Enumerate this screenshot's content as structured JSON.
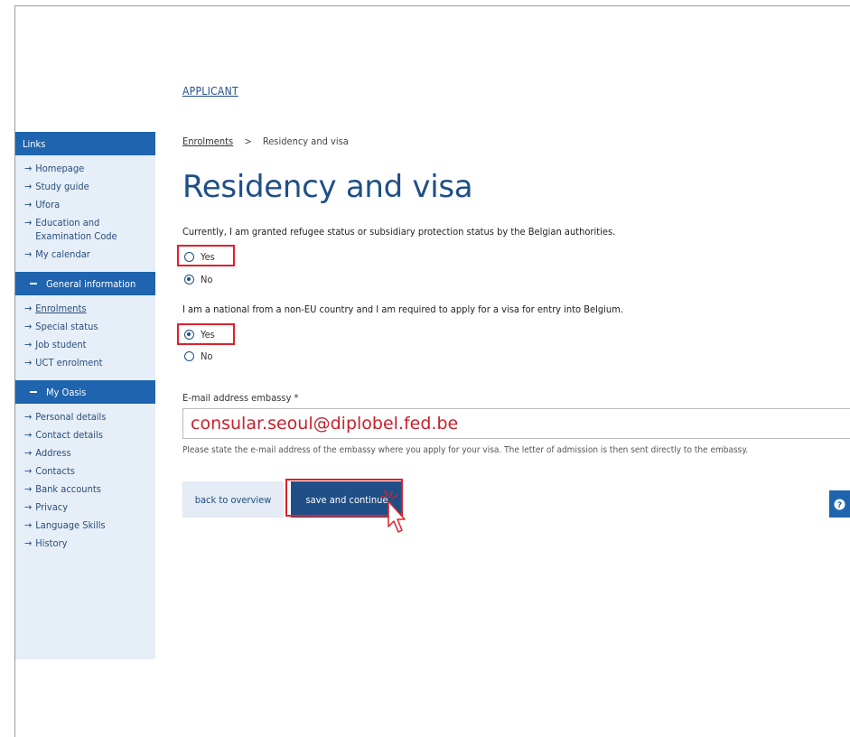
{
  "header": {
    "applicant": "APPLICANT"
  },
  "breadcrumb": {
    "link": "Enrolments",
    "separator": ">",
    "current": "Residency and visa"
  },
  "page": {
    "title": "Residency and visa"
  },
  "sidebar": {
    "links_header": "Links",
    "links": [
      "Homepage",
      "Study guide",
      "Ufora",
      "Education and",
      "Examination Code",
      "My calendar"
    ],
    "general_header": "General information",
    "general": [
      "Enrolments",
      "Special status",
      "Job student",
      "UCT enrolment"
    ],
    "oasis_header": "My Oasis",
    "oasis": [
      "Personal details",
      "Contact details",
      "Address",
      "Contacts",
      "Bank accounts",
      "Privacy",
      "Language Skills",
      "History"
    ]
  },
  "q1": {
    "text": "Currently, I am granted refugee status or subsidiary protection status by the Belgian authorities.",
    "yes": "Yes",
    "no": "No",
    "selected": "No"
  },
  "q2": {
    "text": "I am a national from a non-EU country and I am required to apply for a visa for entry into Belgium.",
    "yes": "Yes",
    "no": "No",
    "selected": "Yes"
  },
  "email": {
    "label": "E-mail address embassy *",
    "value": "consular.seoul@diplobel.fed.be",
    "help": "Please state the e-mail address of the embassy where you apply for your visa. The letter of admission is then sent directly to the embassy."
  },
  "buttons": {
    "back": "back to overview",
    "save": "save and continue"
  },
  "colors": {
    "primary": "#1f4f86",
    "sidebar_header": "#1f64ae",
    "sidebar_bg": "#e6eef7",
    "highlight": "#e0202b"
  },
  "icons": {
    "help": "question-mark-circle-icon",
    "cursor": "pointer-cursor-icon",
    "arrow": "right-arrow-icon"
  }
}
